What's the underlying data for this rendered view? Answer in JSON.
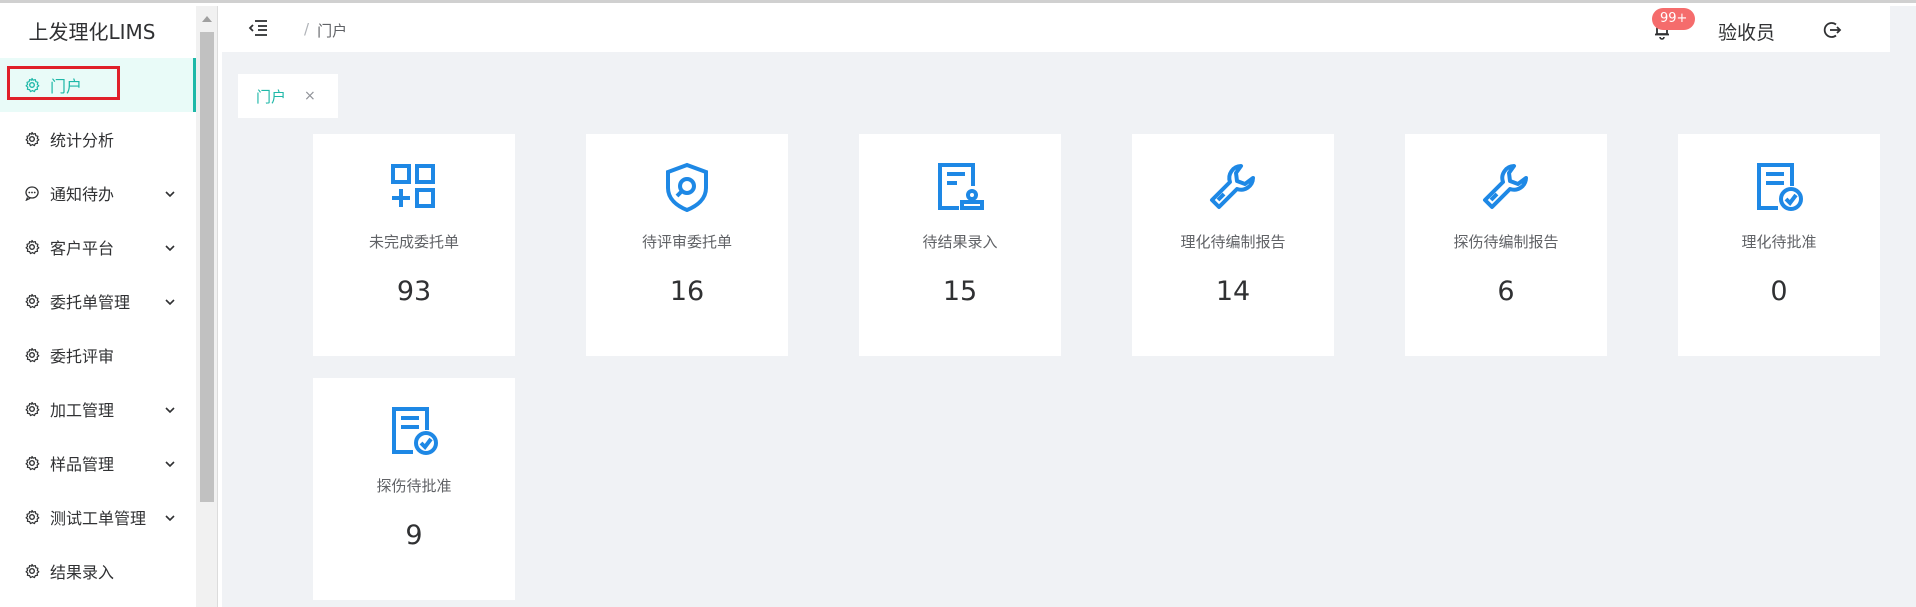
{
  "app": {
    "title": "上发理化LIMS"
  },
  "sidebar": {
    "items": [
      {
        "label": "门户",
        "icon": "gear-icon",
        "active": true,
        "has_children": false
      },
      {
        "label": "统计分析",
        "icon": "gear-icon",
        "active": false,
        "has_children": false
      },
      {
        "label": "通知待办",
        "icon": "chat-bubble-icon",
        "active": false,
        "has_children": true
      },
      {
        "label": "客户平台",
        "icon": "gear-icon",
        "active": false,
        "has_children": true
      },
      {
        "label": "委托单管理",
        "icon": "gear-icon",
        "active": false,
        "has_children": true
      },
      {
        "label": "委托评审",
        "icon": "gear-icon",
        "active": false,
        "has_children": false
      },
      {
        "label": "加工管理",
        "icon": "gear-icon",
        "active": false,
        "has_children": true
      },
      {
        "label": "样品管理",
        "icon": "gear-icon",
        "active": false,
        "has_children": true
      },
      {
        "label": "测试工单管理",
        "icon": "gear-icon",
        "active": false,
        "has_children": true
      },
      {
        "label": "结果录入",
        "icon": "gear-icon",
        "active": false,
        "has_children": false
      }
    ]
  },
  "header": {
    "breadcrumb_sep": "/",
    "breadcrumb": "门户",
    "notification_badge": "99+",
    "user": "验收员"
  },
  "tabs": [
    {
      "label": "门户",
      "close": "×"
    }
  ],
  "cards": [
    {
      "label": "未完成委托单",
      "value": "93",
      "icon": "grid-add-icon"
    },
    {
      "label": "待评审委托单",
      "value": "16",
      "icon": "shield-search-icon"
    },
    {
      "label": "待结果录入",
      "value": "15",
      "icon": "document-stamp-icon"
    },
    {
      "label": "理化待编制报告",
      "value": "14",
      "icon": "wrench-icon"
    },
    {
      "label": "探伤待编制报告",
      "value": "6",
      "icon": "wrench-icon"
    },
    {
      "label": "理化待批准",
      "value": "0",
      "icon": "document-check-icon"
    },
    {
      "label": "探伤待批准",
      "value": "9",
      "icon": "document-check-icon"
    }
  ],
  "colors": {
    "accent": "#1fb8a8",
    "icon_blue": "#1e88e5",
    "badge": "#f56c6c",
    "highlight": "#e0202a"
  }
}
